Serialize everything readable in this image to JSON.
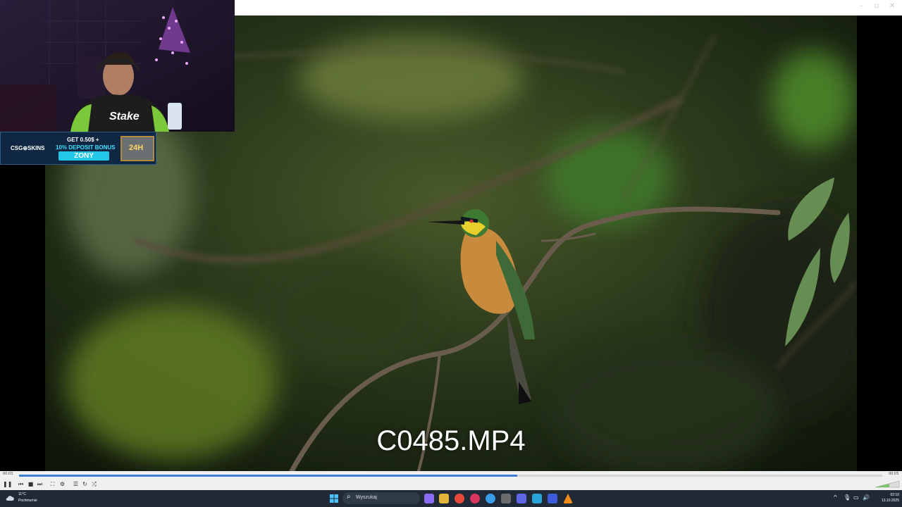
{
  "window": {
    "minimize": "–",
    "maximize": "▫",
    "close": "✕"
  },
  "video": {
    "filename": "C0485.MP4"
  },
  "overlay": {
    "promo": {
      "brand": "CSG⊕SKINS",
      "line1": "GET 0.50$ +",
      "line2": "10% DEPOSIT BONUS",
      "code": "ZONY",
      "case_label": "24H"
    },
    "shirt_text": "Stake"
  },
  "player": {
    "time_elapsed": "00:03",
    "time_total": "00:05",
    "progress": 0.577,
    "volume_label": "",
    "buttons": [
      "pause-icon",
      "prev-icon",
      "stop-icon",
      "next-icon",
      "fullscreen-icon",
      "ext-settings-icon",
      "playlist-icon",
      "loop-icon",
      "shuffle-icon"
    ]
  },
  "taskbar": {
    "weather_temp": "11°C",
    "weather_cond": "Pochmurnie",
    "search_placeholder": "Wyszukaj",
    "time": "02:10",
    "date": "13.10.2025",
    "app_colors": [
      "#8a6cf2",
      "#e2b53a",
      "#e8493a",
      "#d8355e",
      "#3a9ce6",
      "#6b6b6b",
      "#5d66e6",
      "#27a3d8",
      "#3b5bdb",
      "#f08a1a"
    ]
  },
  "colors": {
    "seek_fill": "#3e7cd6",
    "taskbar": "#1f2a36",
    "accent_cyan": "#22c6e6"
  }
}
